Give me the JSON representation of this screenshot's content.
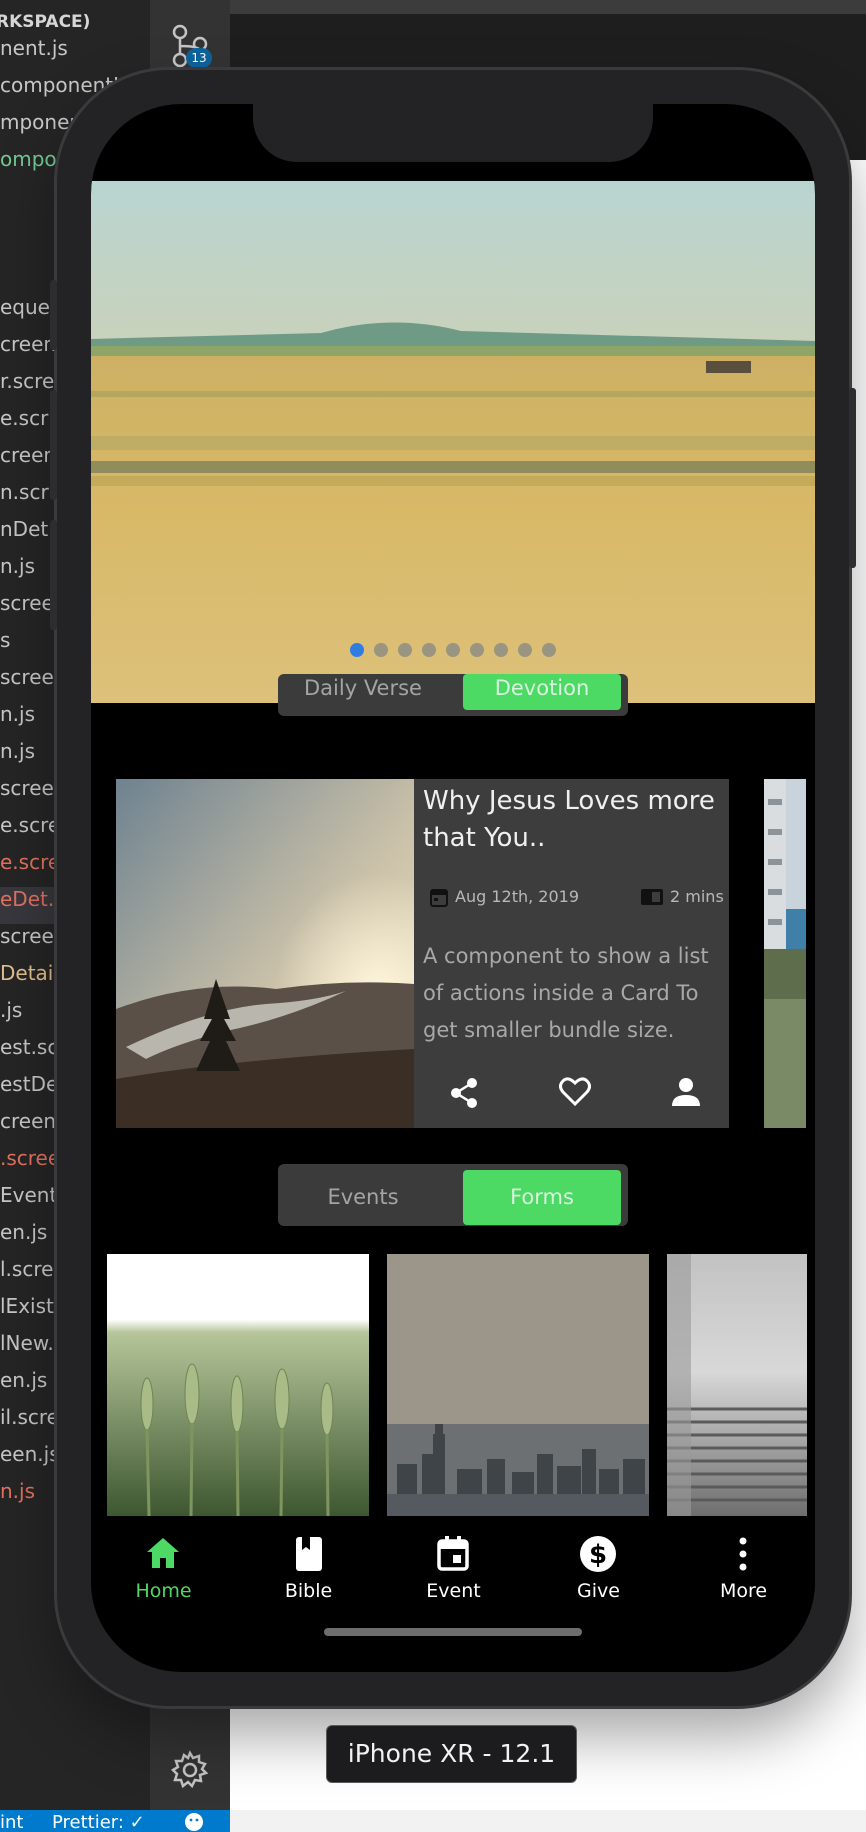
{
  "explorer": {
    "header": "RKSPACE)",
    "files": [
      {
        "name": "nent.js",
        "color": ""
      },
      {
        "name": "componentI",
        "color": ""
      },
      {
        "name": "mponen",
        "color": ""
      },
      {
        "name": "ompon",
        "color": "green"
      },
      {
        "name": "",
        "color": ""
      },
      {
        "name": "",
        "color": ""
      },
      {
        "name": "",
        "color": ""
      },
      {
        "name": "eques",
        "color": ""
      },
      {
        "name": "creen.",
        "color": ""
      },
      {
        "name": "r.scre",
        "color": ""
      },
      {
        "name": "e.scr",
        "color": ""
      },
      {
        "name": "creen",
        "color": ""
      },
      {
        "name": "n.scr",
        "color": ""
      },
      {
        "name": "nDet",
        "color": ""
      },
      {
        "name": "n.js",
        "color": ""
      },
      {
        "name": "screen",
        "color": ""
      },
      {
        "name": "s",
        "color": ""
      },
      {
        "name": "screen",
        "color": ""
      },
      {
        "name": "n.js",
        "color": ""
      },
      {
        "name": "n.js",
        "color": ""
      },
      {
        "name": "screen",
        "color": ""
      },
      {
        "name": "e.scre",
        "color": ""
      },
      {
        "name": "e.scre",
        "color": "red"
      },
      {
        "name": "eDet..",
        "color": "red",
        "selected": true
      },
      {
        "name": "screen",
        "color": ""
      },
      {
        "name": "Detail.",
        "color": "yellow"
      },
      {
        "name": ".js",
        "color": ""
      },
      {
        "name": "est.scr",
        "color": ""
      },
      {
        "name": "estDet",
        "color": ""
      },
      {
        "name": "creen.",
        "color": ""
      },
      {
        "name": ".scree",
        "color": "red"
      },
      {
        "name": "Event",
        "color": ""
      },
      {
        "name": "en.js",
        "color": ""
      },
      {
        "name": "l.scre",
        "color": ""
      },
      {
        "name": "lExist",
        "color": ""
      },
      {
        "name": "lNew.",
        "color": ""
      },
      {
        "name": "en.js",
        "color": ""
      },
      {
        "name": "il.scre",
        "color": ""
      },
      {
        "name": "een.js",
        "color": ""
      },
      {
        "name": "n.js",
        "color": "red"
      }
    ]
  },
  "activity_bar": {
    "scm_badge": "13"
  },
  "status_bar": {
    "lint": "int",
    "prettier": "Prettier: ✓"
  },
  "app": {
    "carousel": {
      "dot_count": 9,
      "active_index": 0
    },
    "segment_top": {
      "left": "Daily Verse",
      "right": "Devotion",
      "selected": "right"
    },
    "devotion_card": {
      "title": "Why Jesus Loves more that You..",
      "date": "Aug 12th, 2019",
      "read_time": "2 mins",
      "description": "A component to show a list of actions inside a Card To get smaller bundle size."
    },
    "segment_bottom": {
      "left": "Events",
      "right": "Forms",
      "selected": "right"
    },
    "tabs": [
      {
        "label": "Home",
        "icon": "home-icon",
        "active": true
      },
      {
        "label": "Bible",
        "icon": "book-icon",
        "active": false
      },
      {
        "label": "Event",
        "icon": "calendar-icon",
        "active": false
      },
      {
        "label": "Give",
        "icon": "dollar-icon",
        "active": false
      },
      {
        "label": "More",
        "icon": "more-vertical-icon",
        "active": false
      }
    ]
  },
  "simulator": {
    "device_label": "iPhone XR - 12.1"
  },
  "colors": {
    "accent_green": "#4cd964",
    "active_dot": "#2f7de1",
    "card_bg": "#3d3d3d"
  }
}
